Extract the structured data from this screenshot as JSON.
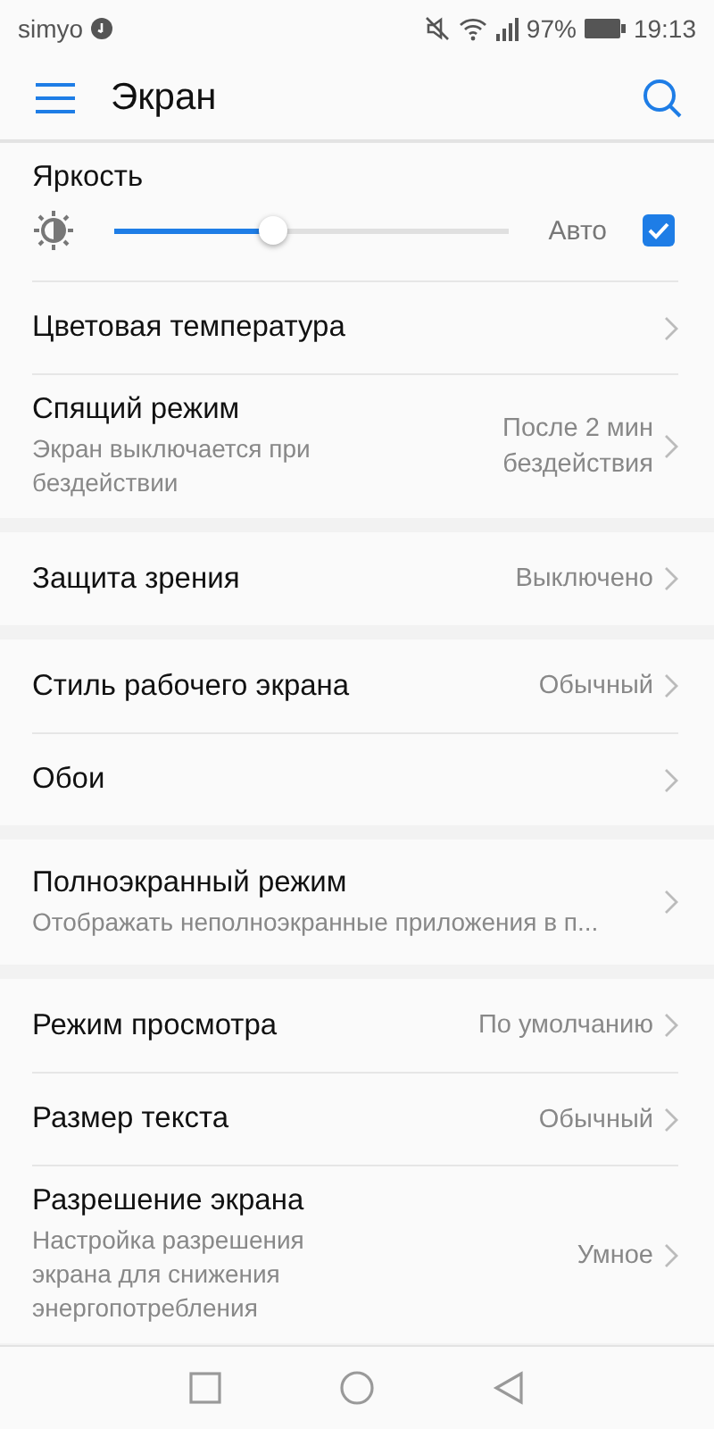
{
  "status_bar": {
    "carrier": "simyo",
    "battery": "97%",
    "time": "19:13"
  },
  "header": {
    "title": "Экран"
  },
  "brightness": {
    "label": "Яркость",
    "level": 0.4,
    "auto_label": "Авто",
    "auto_checked": true
  },
  "groups": [
    [
      {
        "title": "Цветовая температура"
      },
      {
        "title": "Спящий режим",
        "subtitle": "Экран выключается при бездействии",
        "value": "После 2 мин бездействия"
      }
    ],
    [
      {
        "title": "Защита зрения",
        "value": "Выключено"
      }
    ],
    [
      {
        "title": "Стиль рабочего экрана",
        "value": "Обычный"
      },
      {
        "title": "Обои"
      }
    ],
    [
      {
        "title": "Полноэкранный режим",
        "subtitle": "Отображать неполноэкранные приложения в п..."
      }
    ],
    [
      {
        "title": "Режим просмотра",
        "value": "По умолчанию"
      },
      {
        "title": "Размер текста",
        "value": "Обычный"
      },
      {
        "title": "Разрешение экрана",
        "subtitle": "Настройка разрешения экрана для снижения энергопотребления",
        "value": "Умное"
      }
    ]
  ]
}
